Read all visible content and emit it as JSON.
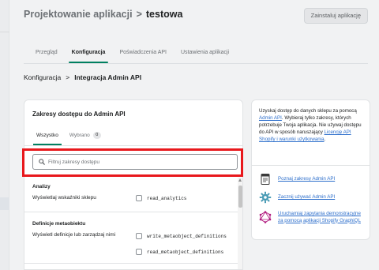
{
  "header": {
    "parent": "Projektowanie aplikacji",
    "separator": ">",
    "current": "testowa",
    "install_button": "Zainstaluj aplikację"
  },
  "tabs": [
    "Przegląd",
    "Konfiguracja",
    "Poświadczenia API",
    "Ustawienia aplikacji"
  ],
  "breadcrumb": {
    "parent": "Konfiguracja",
    "separator": ">",
    "current": "Integracja Admin API"
  },
  "scopes_card": {
    "title": "Zakresy dostępu do Admin API",
    "subtabs": {
      "all": "Wszystko",
      "selected": "Wybrano",
      "selected_count": "0"
    },
    "search": {
      "placeholder": "Filtruj zakresy dostępu",
      "value": ""
    },
    "sections": [
      {
        "title": "Analizy",
        "description": "Wyświetlaj wskaźniki sklepu",
        "scopes": [
          "read_analytics"
        ]
      },
      {
        "title": "Definicje metaobiektu",
        "description": "Wyświetl definicje lub zarządzaj nimi",
        "scopes": [
          "write_metaobject_definitions",
          "read_metaobject_definitions"
        ]
      }
    ]
  },
  "side_card": {
    "intro_1": "Uzyskaj dostęp do danych sklepu za pomocą ",
    "intro_link_1": "Admin API",
    "intro_2": ". Wybieraj tylko zakresy, których potrzebuje Twoja aplikacja. Nie używaj dostępu do API w sposób naruszający ",
    "intro_link_2": "Licencję API Shopify i warunki użytkowania",
    "intro_3": ".",
    "links": [
      {
        "label": "Poznaj zakresy Admin API",
        "icon": "document-icon"
      },
      {
        "label": "Zacznij używać Admin API",
        "icon": "gear-icon"
      },
      {
        "label": "Uruchamiaj zapytania demonstracyjne za pomocą aplikacji Shopify GraphiQL",
        "icon": "graphql-icon"
      }
    ]
  },
  "colors": {
    "accent": "#008060",
    "link": "#2c6ecb",
    "highlight": "#e8181c"
  }
}
